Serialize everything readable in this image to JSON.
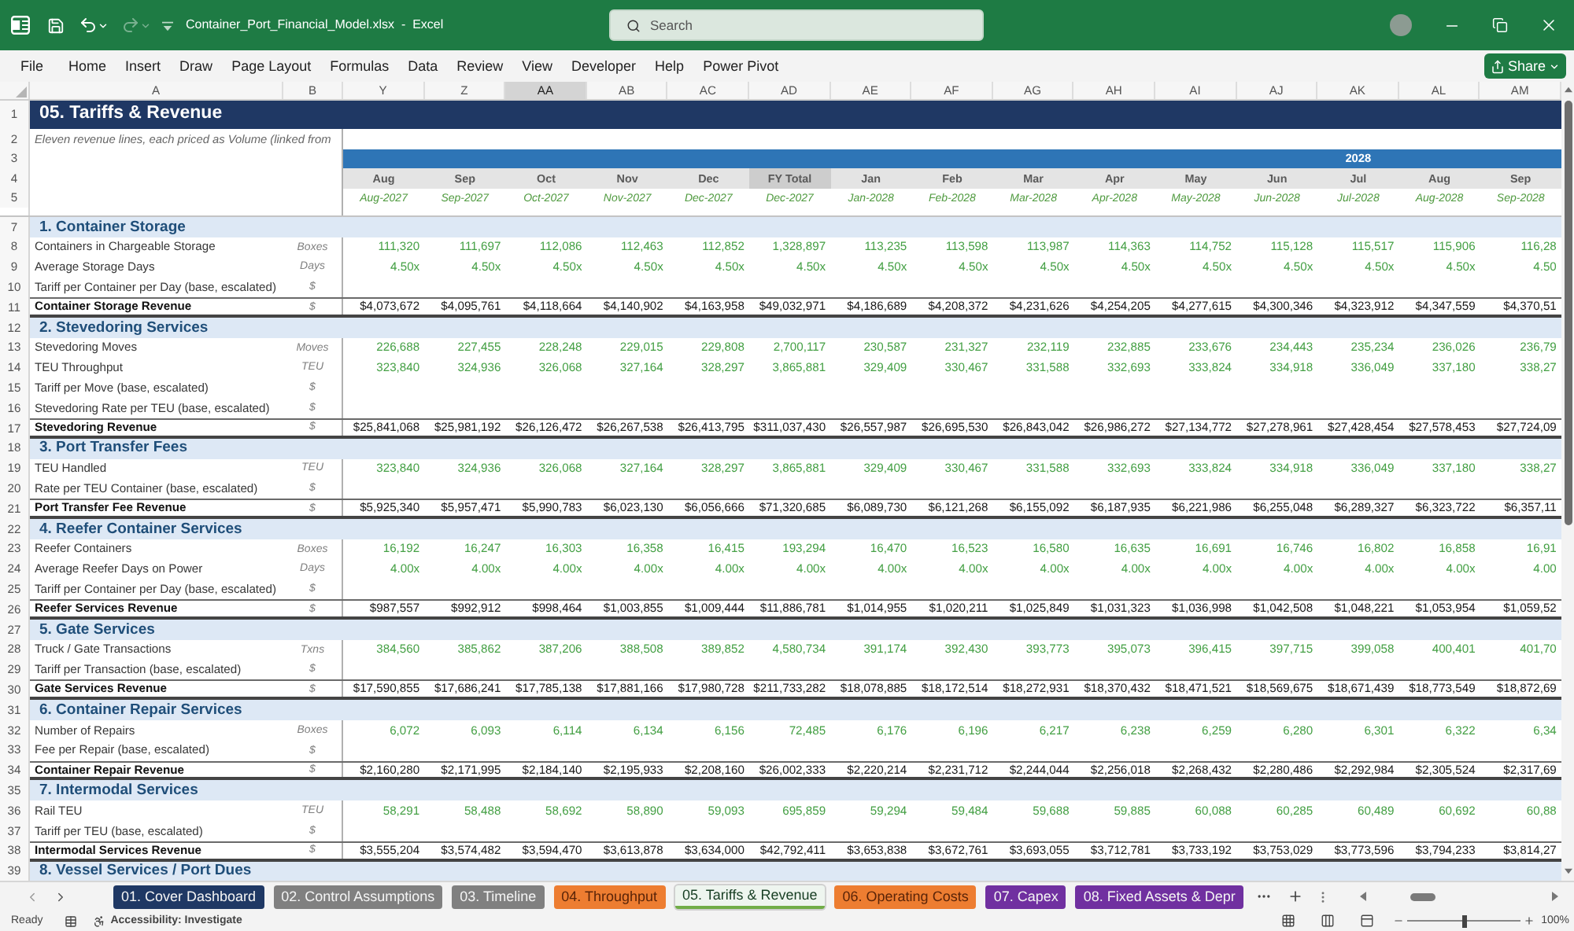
{
  "window": {
    "title": "Container_Port_Financial_Model.xlsx  -  Excel"
  },
  "search": {
    "placeholder": "Search"
  },
  "menu": [
    "File",
    "Home",
    "Insert",
    "Draw",
    "Page Layout",
    "Formulas",
    "Data",
    "Review",
    "View",
    "Developer",
    "Help",
    "Power Pivot"
  ],
  "share_button": "Share",
  "column_headers": [
    {
      "label": "A",
      "selected": false
    },
    {
      "label": "B",
      "selected": false
    },
    {
      "label": "Y",
      "selected": false
    },
    {
      "label": "Z",
      "selected": false
    },
    {
      "label": "AA",
      "selected": true
    },
    {
      "label": "AB",
      "selected": false
    },
    {
      "label": "AC",
      "selected": false
    },
    {
      "label": "AD",
      "selected": false
    },
    {
      "label": "AE",
      "selected": false
    },
    {
      "label": "AF",
      "selected": false
    },
    {
      "label": "AG",
      "selected": false
    },
    {
      "label": "AH",
      "selected": false
    },
    {
      "label": "AI",
      "selected": false
    },
    {
      "label": "AJ",
      "selected": false
    },
    {
      "label": "AK",
      "selected": false
    },
    {
      "label": "AL",
      "selected": false
    },
    {
      "label": "AM",
      "selected": false
    }
  ],
  "sheet": {
    "header_row_numbers": [
      "1",
      "2",
      "3",
      "4",
      "5"
    ],
    "title": "05. Tariffs & Revenue",
    "subtitle": "Eleven revenue lines, each priced as Volume (linked from",
    "periods": [
      {
        "month": "Aug",
        "date": "Aug-2027",
        "kind": "month"
      },
      {
        "month": "Sep",
        "date": "Sep-2027",
        "kind": "month"
      },
      {
        "month": "Oct",
        "date": "Oct-2027",
        "kind": "month"
      },
      {
        "month": "Nov",
        "date": "Nov-2027",
        "kind": "month"
      },
      {
        "month": "Dec",
        "date": "Dec-2027",
        "kind": "month"
      },
      {
        "month": "FY Total",
        "date": "Dec-2027",
        "kind": "total"
      },
      {
        "month": "Jan",
        "date": "Jan-2028",
        "kind": "month"
      },
      {
        "month": "Feb",
        "date": "Feb-2028",
        "kind": "month"
      },
      {
        "month": "Mar",
        "date": "Mar-2028",
        "kind": "month"
      },
      {
        "month": "Apr",
        "date": "Apr-2028",
        "kind": "month"
      },
      {
        "month": "May",
        "date": "May-2028",
        "kind": "month"
      },
      {
        "month": "Jun",
        "date": "Jun-2028",
        "kind": "month"
      },
      {
        "month": "Jul",
        "date": "Jul-2028",
        "kind": "month",
        "year": "2028"
      },
      {
        "month": "Aug",
        "date": "Aug-2028",
        "kind": "month"
      },
      {
        "month": "Sep",
        "date": "Sep-2028",
        "kind": "month"
      }
    ],
    "rows": [
      {
        "number": "7",
        "kind": "section",
        "label": "1. Container Storage"
      },
      {
        "number": "8",
        "kind": "line",
        "label": "Containers in Chargeable Storage",
        "unit": "Boxes",
        "values": [
          "111,320",
          "111,697",
          "112,086",
          "112,463",
          "112,852",
          "1,328,897",
          "113,235",
          "113,598",
          "113,987",
          "114,363",
          "114,752",
          "115,128",
          "115,517",
          "115,906",
          "116,28"
        ]
      },
      {
        "number": "9",
        "kind": "line",
        "label": "Average Storage Days",
        "unit": "Days",
        "values": [
          "4.50x",
          "4.50x",
          "4.50x",
          "4.50x",
          "4.50x",
          "4.50x",
          "4.50x",
          "4.50x",
          "4.50x",
          "4.50x",
          "4.50x",
          "4.50x",
          "4.50x",
          "4.50x",
          "4.50"
        ]
      },
      {
        "number": "10",
        "kind": "line",
        "label": "Tariff per Container per Day (base, escalated)",
        "unit": "$"
      },
      {
        "number": "11",
        "kind": "total",
        "label": "Container Storage Revenue",
        "unit": "$",
        "values": [
          "$4,073,672",
          "$4,095,761",
          "$4,118,664",
          "$4,140,902",
          "$4,163,958",
          "$49,032,971",
          "$4,186,689",
          "$4,208,372",
          "$4,231,626",
          "$4,254,205",
          "$4,277,615",
          "$4,300,346",
          "$4,323,912",
          "$4,347,559",
          "$4,370,51"
        ]
      },
      {
        "number": "12",
        "kind": "section",
        "label": "2. Stevedoring Services"
      },
      {
        "number": "13",
        "kind": "line",
        "label": "Stevedoring Moves",
        "unit": "Moves",
        "values": [
          "226,688",
          "227,455",
          "228,248",
          "229,015",
          "229,808",
          "2,700,117",
          "230,587",
          "231,327",
          "232,119",
          "232,885",
          "233,676",
          "234,443",
          "235,234",
          "236,026",
          "236,79"
        ]
      },
      {
        "number": "14",
        "kind": "line",
        "label": "TEU Throughput",
        "unit": "TEU",
        "values": [
          "323,840",
          "324,936",
          "326,068",
          "327,164",
          "328,297",
          "3,865,881",
          "329,409",
          "330,467",
          "331,588",
          "332,693",
          "333,824",
          "334,918",
          "336,049",
          "337,180",
          "338,27"
        ]
      },
      {
        "number": "15",
        "kind": "line",
        "label": "Tariff per Move (base, escalated)",
        "unit": "$"
      },
      {
        "number": "16",
        "kind": "line",
        "label": "Stevedoring Rate per TEU (base, escalated)",
        "unit": "$"
      },
      {
        "number": "17",
        "kind": "total",
        "label": "Stevedoring Revenue",
        "unit": "$",
        "values": [
          "$25,841,068",
          "$25,981,192",
          "$26,126,472",
          "$26,267,538",
          "$26,413,795",
          "$311,037,430",
          "$26,557,987",
          "$26,695,530",
          "$26,843,042",
          "$26,986,272",
          "$27,134,772",
          "$27,278,961",
          "$27,428,454",
          "$27,578,453",
          "$27,724,09"
        ]
      },
      {
        "number": "18",
        "kind": "section",
        "label": "3. Port Transfer Fees"
      },
      {
        "number": "19",
        "kind": "line",
        "label": "TEU Handled",
        "unit": "TEU",
        "values": [
          "323,840",
          "324,936",
          "326,068",
          "327,164",
          "328,297",
          "3,865,881",
          "329,409",
          "330,467",
          "331,588",
          "332,693",
          "333,824",
          "334,918",
          "336,049",
          "337,180",
          "338,27"
        ]
      },
      {
        "number": "20",
        "kind": "line",
        "label": "Rate per TEU Container (base, escalated)",
        "unit": "$"
      },
      {
        "number": "21",
        "kind": "total",
        "label": "Port Transfer Fee Revenue",
        "unit": "$",
        "values": [
          "$5,925,340",
          "$5,957,471",
          "$5,990,783",
          "$6,023,130",
          "$6,056,666",
          "$71,320,685",
          "$6,089,730",
          "$6,121,268",
          "$6,155,092",
          "$6,187,935",
          "$6,221,986",
          "$6,255,048",
          "$6,289,327",
          "$6,323,722",
          "$6,357,11"
        ]
      },
      {
        "number": "22",
        "kind": "section",
        "label": "4. Reefer Container Services"
      },
      {
        "number": "23",
        "kind": "line",
        "label": "Reefer Containers",
        "unit": "Boxes",
        "values": [
          "16,192",
          "16,247",
          "16,303",
          "16,358",
          "16,415",
          "193,294",
          "16,470",
          "16,523",
          "16,580",
          "16,635",
          "16,691",
          "16,746",
          "16,802",
          "16,858",
          "16,91"
        ]
      },
      {
        "number": "24",
        "kind": "line",
        "label": "Average Reefer Days on Power",
        "unit": "Days",
        "values": [
          "4.00x",
          "4.00x",
          "4.00x",
          "4.00x",
          "4.00x",
          "4.00x",
          "4.00x",
          "4.00x",
          "4.00x",
          "4.00x",
          "4.00x",
          "4.00x",
          "4.00x",
          "4.00x",
          "4.00"
        ]
      },
      {
        "number": "25",
        "kind": "line",
        "label": "Tariff per Container per Day (base, escalated)",
        "unit": "$"
      },
      {
        "number": "26",
        "kind": "total",
        "label": "Reefer Services Revenue",
        "unit": "$",
        "values": [
          "$987,557",
          "$992,912",
          "$998,464",
          "$1,003,855",
          "$1,009,444",
          "$11,886,781",
          "$1,014,955",
          "$1,020,211",
          "$1,025,849",
          "$1,031,323",
          "$1,036,998",
          "$1,042,508",
          "$1,048,221",
          "$1,053,954",
          "$1,059,52"
        ]
      },
      {
        "number": "27",
        "kind": "section",
        "label": "5. Gate Services"
      },
      {
        "number": "28",
        "kind": "line",
        "label": "Truck / Gate Transactions",
        "unit": "Txns",
        "values": [
          "384,560",
          "385,862",
          "387,206",
          "388,508",
          "389,852",
          "4,580,734",
          "391,174",
          "392,430",
          "393,773",
          "395,073",
          "396,415",
          "397,715",
          "399,058",
          "400,401",
          "401,70"
        ]
      },
      {
        "number": "29",
        "kind": "line",
        "label": "Tariff per Transaction (base, escalated)",
        "unit": "$"
      },
      {
        "number": "30",
        "kind": "total",
        "label": "Gate Services Revenue",
        "unit": "$",
        "values": [
          "$17,590,855",
          "$17,686,241",
          "$17,785,138",
          "$17,881,166",
          "$17,980,728",
          "$211,733,282",
          "$18,078,885",
          "$18,172,514",
          "$18,272,931",
          "$18,370,432",
          "$18,471,521",
          "$18,569,675",
          "$18,671,439",
          "$18,773,549",
          "$18,872,69"
        ]
      },
      {
        "number": "31",
        "kind": "section",
        "label": "6. Container Repair Services"
      },
      {
        "number": "32",
        "kind": "line",
        "label": "Number of Repairs",
        "unit": "Boxes",
        "values": [
          "6,072",
          "6,093",
          "6,114",
          "6,134",
          "6,156",
          "72,485",
          "6,176",
          "6,196",
          "6,217",
          "6,238",
          "6,259",
          "6,280",
          "6,301",
          "6,322",
          "6,34"
        ]
      },
      {
        "number": "33",
        "kind": "line",
        "label": "Fee per Repair (base, escalated)",
        "unit": "$"
      },
      {
        "number": "34",
        "kind": "total",
        "label": "Container Repair Revenue",
        "unit": "$",
        "values": [
          "$2,160,280",
          "$2,171,995",
          "$2,184,140",
          "$2,195,933",
          "$2,208,160",
          "$26,002,333",
          "$2,220,214",
          "$2,231,712",
          "$2,244,044",
          "$2,256,018",
          "$2,268,432",
          "$2,280,486",
          "$2,292,984",
          "$2,305,524",
          "$2,317,69"
        ]
      },
      {
        "number": "35",
        "kind": "section",
        "label": "7. Intermodal Services"
      },
      {
        "number": "36",
        "kind": "line",
        "label": "Rail TEU",
        "unit": "TEU",
        "values": [
          "58,291",
          "58,488",
          "58,692",
          "58,890",
          "59,093",
          "695,859",
          "59,294",
          "59,484",
          "59,688",
          "59,885",
          "60,088",
          "60,285",
          "60,489",
          "60,692",
          "60,88"
        ]
      },
      {
        "number": "37",
        "kind": "line",
        "label": "Tariff per TEU (base, escalated)",
        "unit": "$"
      },
      {
        "number": "38",
        "kind": "total",
        "label": "Intermodal Services Revenue",
        "unit": "$",
        "values": [
          "$3,555,204",
          "$3,574,482",
          "$3,594,470",
          "$3,613,878",
          "$3,634,000",
          "$42,792,411",
          "$3,653,838",
          "$3,672,761",
          "$3,693,055",
          "$3,712,781",
          "$3,733,192",
          "$3,753,029",
          "$3,773,596",
          "$3,794,233",
          "$3,814,27"
        ]
      },
      {
        "number": "39",
        "kind": "section",
        "label": "8. Vessel Services / Port Dues"
      }
    ]
  },
  "tabs": [
    {
      "label": "01. Cover Dashboard",
      "color": "#1f3864",
      "selected": false
    },
    {
      "label": "02. Control Assumptions",
      "color": "#808080",
      "selected": false
    },
    {
      "label": "03. Timeline",
      "color": "#808080",
      "selected": false
    },
    {
      "label": "04. Throughput",
      "color": "#ed7d31",
      "selected": false
    },
    {
      "label": "05. Tariffs & Revenue",
      "color": "#70ad47",
      "selected": true
    },
    {
      "label": "06. Operating Costs",
      "color": "#ed7d31",
      "selected": false
    },
    {
      "label": "07. Capex",
      "color": "#7030a0",
      "selected": false
    },
    {
      "label": "08. Fixed Assets & Depr",
      "color": "#7030a0",
      "selected": false
    }
  ],
  "status_bar": {
    "mode": "Ready",
    "accessibility": "Accessibility: Investigate"
  },
  "zoom": {
    "label": "100%",
    "level": 0.5
  }
}
